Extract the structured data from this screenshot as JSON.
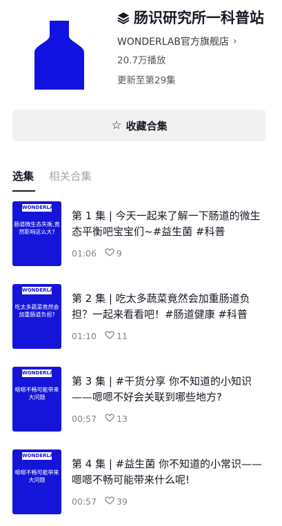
{
  "collection": {
    "title": "肠识研究所一科普站",
    "author": "WONDERLAB官方旗舰店",
    "plays": "20.7万播放",
    "updated": "更新至第29集",
    "cover_color": "#1212e0"
  },
  "collect_button": {
    "label": "收藏合集"
  },
  "tabs": [
    {
      "label": "选集",
      "active": true
    },
    {
      "label": "相关合集",
      "active": false
    }
  ],
  "episodes": [
    {
      "title": "第 1 集 | 今天一起来了解一下肠道的微生态平衡吧宝宝们~#益生菌 #科普",
      "duration": "01:06",
      "likes": "9",
      "thumb_logo": "WONDERLAB",
      "thumb_text": "肠道微生态失衡,竟然影响这么大?"
    },
    {
      "title": "第 2 集 | 吃太多蔬菜竟然会加重肠道负担？一起来看看吧！#肠道健康 #科普",
      "duration": "01:10",
      "likes": "11",
      "thumb_logo": "WONDERLAB",
      "thumb_text": "吃太多蔬菜竟然会加重肠道负担?"
    },
    {
      "title": "第 3 集 | #干货分享 你不知道的小知识——嗯嗯不好会关联到哪些地方?",
      "duration": "00:57",
      "likes": "13",
      "thumb_logo": "WONDERLAB",
      "thumb_text": "嗯嗯不畅可能带来大问题"
    },
    {
      "title": "第 4 集 | #益生菌 你不知道的小常识——嗯嗯不畅可能带来什么呢!",
      "duration": "00:57",
      "likes": "39",
      "thumb_logo": "WONDERLAB",
      "thumb_text": "嗯嗯不畅可能带来大问题"
    }
  ]
}
